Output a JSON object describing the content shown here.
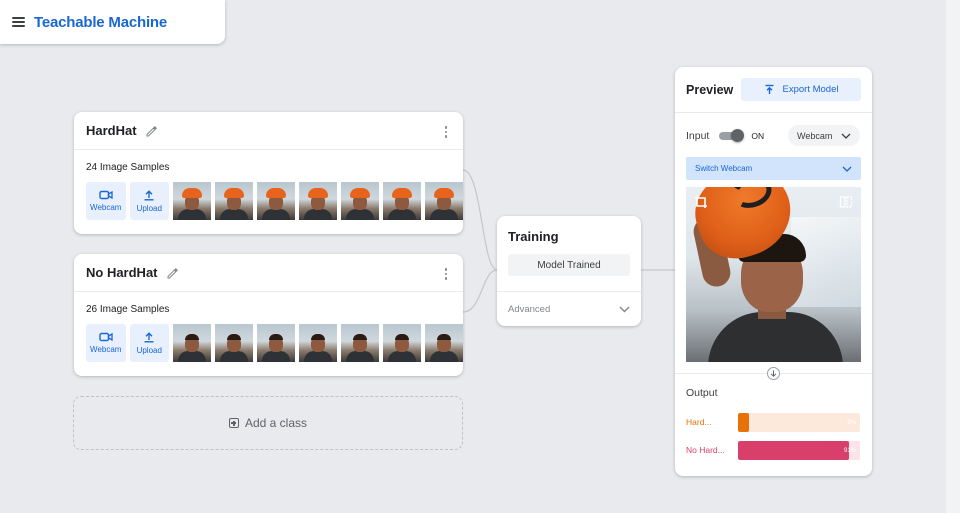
{
  "app": {
    "title": "Teachable Machine"
  },
  "classes": [
    {
      "name": "HardHat",
      "samples_label": "24 Image Samples",
      "webcam_label": "Webcam",
      "upload_label": "Upload",
      "hat": true
    },
    {
      "name": "No HardHat",
      "samples_label": "26 Image Samples",
      "webcam_label": "Webcam",
      "upload_label": "Upload",
      "hat": false
    }
  ],
  "add_class": {
    "label": "Add a class"
  },
  "training": {
    "title": "Training",
    "status_label": "Model Trained",
    "advanced_label": "Advanced"
  },
  "preview": {
    "title": "Preview",
    "export_label": "Export Model",
    "input_label": "Input",
    "toggle_state": "ON",
    "source_select": "Webcam",
    "switch_select": "Switch Webcam",
    "output_title": "Output",
    "outputs": [
      {
        "label": "Hard...",
        "value": 0.09,
        "value_text": "9%",
        "color": "#e8710a",
        "track": "#fde9dc"
      },
      {
        "label": "No Hard...",
        "value": 0.91,
        "value_text": "91%",
        "color": "#d93f6b",
        "track": "#fbe3ea"
      }
    ]
  },
  "colors": {
    "accent": "#1967d2",
    "background": "#e8eaed"
  }
}
